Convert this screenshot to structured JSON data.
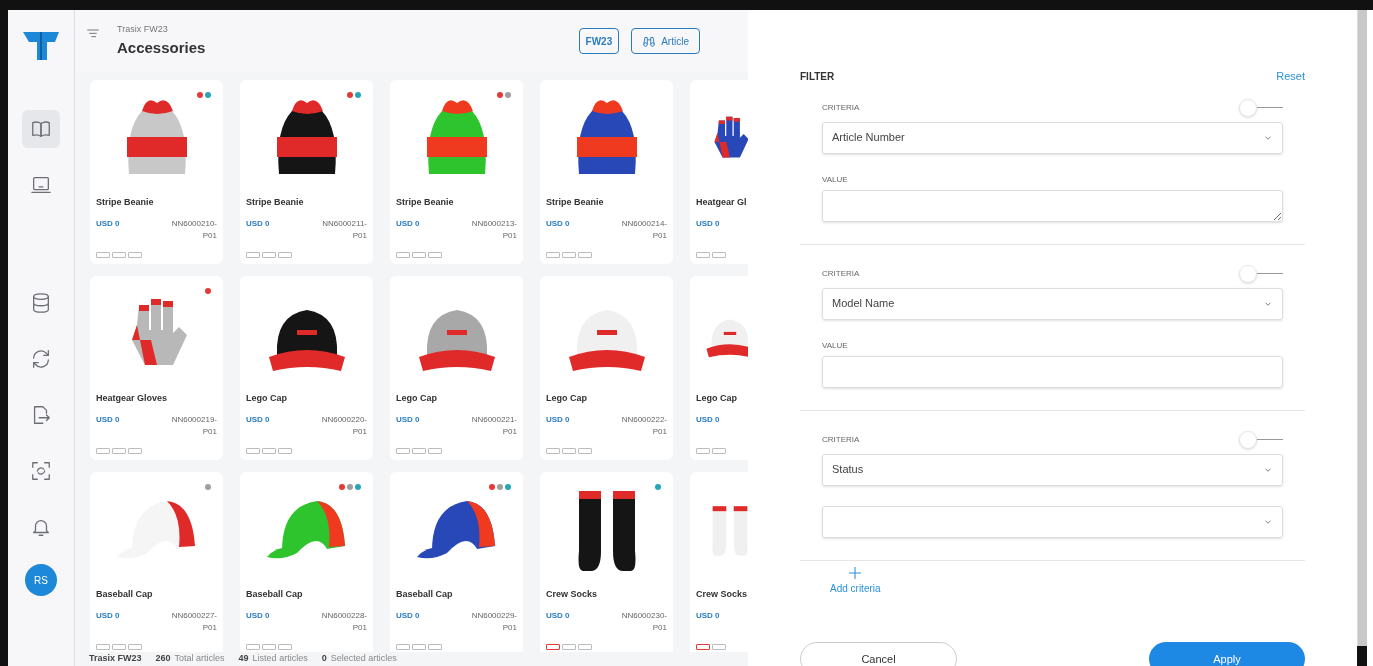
{
  "header": {
    "subtitle": "Trasix FW23",
    "title": "Accessories",
    "buttons": [
      {
        "kind": "plain",
        "label": "FW23"
      },
      {
        "kind": "binoculars",
        "label": "Article"
      }
    ]
  },
  "sidebar": {
    "items": [
      {
        "kind": "book",
        "selected": true
      },
      {
        "kind": "laptop",
        "selected": false
      },
      {
        "kind": "database",
        "selected": false
      },
      {
        "kind": "sync",
        "selected": false
      },
      {
        "kind": "export",
        "selected": false
      },
      {
        "kind": "scan",
        "selected": false
      },
      {
        "kind": "bell",
        "selected": false
      }
    ],
    "avatar": "RS"
  },
  "articles": [
    {
      "name": "Stripe Beanie",
      "price": "USD 0",
      "number": "NN6000210-",
      "suffix": "P01",
      "kind": "beanie",
      "dots": [
        {
          "color": "#e53935"
        },
        {
          "color": "#26a6b8"
        }
      ],
      "flagged": false
    },
    {
      "name": "Stripe Beanie",
      "price": "USD 0",
      "number": "NN6000211-",
      "suffix": "P01",
      "kind": "beanie",
      "dots": [
        {
          "color": "#e53935"
        },
        {
          "color": "#26a6b8"
        }
      ],
      "flagged": false
    },
    {
      "name": "Stripe Beanie",
      "price": "USD 0",
      "number": "NN6000213-",
      "suffix": "P01",
      "kind": "beanie",
      "dots": [
        {
          "color": "#e53935"
        },
        {
          "color": "#9e9e9e"
        }
      ],
      "flagged": false
    },
    {
      "name": "Stripe Beanie",
      "price": "USD 0",
      "number": "NN6000214-",
      "suffix": "P01",
      "kind": "beanie",
      "flagged": false
    },
    {
      "name": "Heatgear Gl",
      "price": "USD 0",
      "kind": "glove",
      "flagged": false
    },
    {
      "name": "Heatgear Gloves",
      "price": "USD 0",
      "number": "NN6000219-",
      "suffix": "P01",
      "kind": "glove",
      "dots": [
        {
          "color": "#e53935"
        }
      ],
      "flagged": false
    },
    {
      "name": "Lego Cap",
      "price": "USD 0",
      "number": "NN6000220-",
      "suffix": "P01",
      "kind": "flat-cap",
      "flagged": false
    },
    {
      "name": "Lego Cap",
      "price": "USD 0",
      "number": "NN6000221-",
      "suffix": "P01",
      "kind": "flat-cap",
      "flagged": false
    },
    {
      "name": "Lego Cap",
      "price": "USD 0",
      "number": "NN6000222-",
      "suffix": "P01",
      "kind": "flat-cap",
      "flagged": false
    },
    {
      "name": "Lego Cap",
      "price": "USD 0",
      "kind": "flat-cap",
      "flagged": false
    },
    {
      "name": "Baseball Cap",
      "price": "USD 0",
      "number": "NN6000227-",
      "suffix": "P01",
      "kind": "baseball-cap",
      "dots": [
        {
          "color": "#9e9e9e"
        }
      ],
      "flagged": false
    },
    {
      "name": "Baseball Cap",
      "price": "USD 0",
      "number": "NN6000228-",
      "suffix": "P01",
      "kind": "baseball-cap",
      "dots": [
        {
          "color": "#e53935"
        },
        {
          "color": "#9e9e9e"
        },
        {
          "color": "#26a6b8"
        }
      ],
      "flagged": false
    },
    {
      "name": "Baseball Cap",
      "price": "USD 0",
      "number": "NN6000229-",
      "suffix": "P01",
      "kind": "baseball-cap",
      "dots": [
        {
          "color": "#e53935"
        },
        {
          "color": "#9e9e9e"
        },
        {
          "color": "#26a6b8"
        }
      ],
      "flagged": false
    },
    {
      "name": "Crew Socks",
      "price": "USD 0",
      "number": "NN6000230-",
      "suffix": "P01",
      "kind": "socks",
      "dots": [
        {
          "color": "#26a6b8"
        }
      ],
      "flagged": true
    },
    {
      "name": "Crew Socks",
      "price": "USD 0",
      "kind": "socks",
      "flagged": true
    }
  ],
  "footer": [
    {
      "count": "Trasix FW23"
    },
    {
      "count": "260",
      "label": "Total articles"
    },
    {
      "count": "49",
      "label": "Listed articles"
    },
    {
      "count": "0",
      "label": "Selected articles"
    }
  ],
  "filter": {
    "title": "FILTER",
    "reset": "Reset",
    "add": "Add criteria",
    "cancel": "Cancel",
    "apply": "Apply",
    "criteria": [
      {
        "label": "CRITERIA",
        "on": false,
        "field": "Article Number",
        "kind": "textarea",
        "value_label": "VALUE"
      },
      {
        "label": "CRITERIA",
        "on": false,
        "field": "Model Name",
        "kind": "input",
        "value_label": "VALUE"
      },
      {
        "label": "CRITERIA",
        "on": false,
        "field": "Status",
        "kind": "select"
      }
    ]
  }
}
